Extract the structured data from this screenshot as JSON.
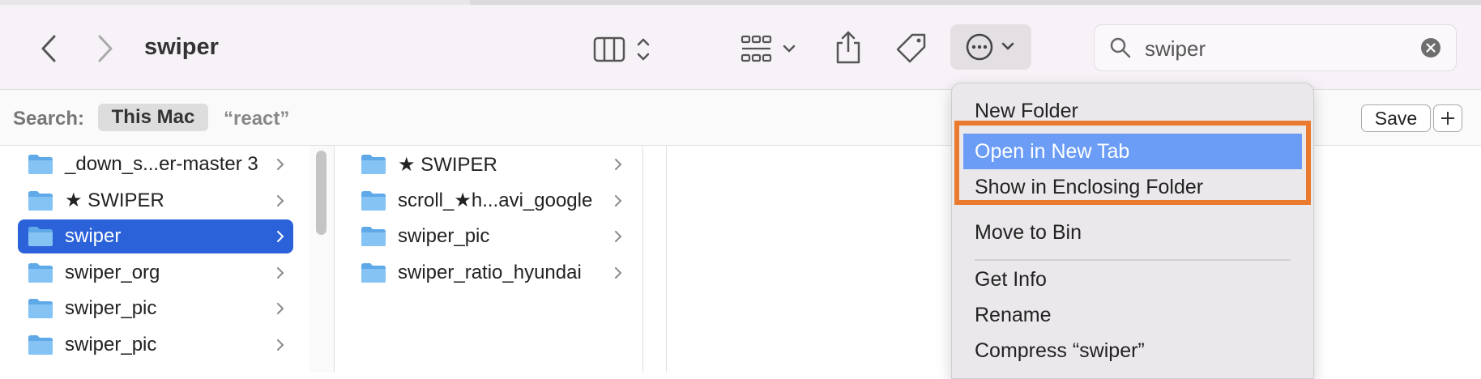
{
  "window": {
    "title": "swiper"
  },
  "toolbar": {
    "back_icon": "chevron-left-icon",
    "forward_icon": "chevron-right-icon",
    "view_columns_icon": "columns-view-icon",
    "view_grid_icon": "grid-view-icon",
    "share_icon": "share-icon",
    "tag_icon": "tag-icon",
    "more_icon": "ellipsis-circle-icon"
  },
  "search": {
    "value": "swiper",
    "icon": "magnifier-icon",
    "clear_icon": "clear-icon"
  },
  "scope": {
    "label": "Search:",
    "this_mac": "This Mac",
    "react": "“react”",
    "save": "Save",
    "add_icon": "plus-icon"
  },
  "column1": {
    "items": [
      {
        "label": "_down_s...er-master 3"
      },
      {
        "label": "★ SWIPER"
      },
      {
        "label": "swiper",
        "selected": true
      },
      {
        "label": "swiper_org"
      },
      {
        "label": "swiper_pic"
      },
      {
        "label": "swiper_pic"
      }
    ]
  },
  "column2": {
    "items": [
      {
        "label": "★ SWIPER"
      },
      {
        "label": "scroll_★h...avi_google"
      },
      {
        "label": "swiper_pic"
      },
      {
        "label": "swiper_ratio_hyundai"
      }
    ]
  },
  "context_menu": {
    "items": [
      "New Folder",
      "Open in New Tab",
      "Show in Enclosing Folder",
      "Move to Bin",
      "Get Info",
      "Rename",
      "Compress “swiper”"
    ],
    "highlighted": "Open in New Tab"
  },
  "colors": {
    "accent": "#2b62d9",
    "menu_highlight": "#6b9cf6",
    "annotation": "#ea7a2d"
  }
}
